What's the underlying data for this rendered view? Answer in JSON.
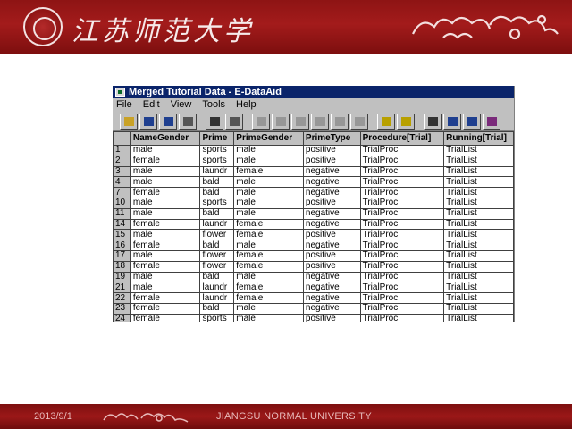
{
  "slide": {
    "university_name": "江苏师范大学",
    "footer_date": "2013/9/1",
    "footer_university": "JIANGSU NORMAL UNIVERSITY"
  },
  "window": {
    "title": "Merged Tutorial Data - E-DataAid",
    "menu": [
      "File",
      "Edit",
      "View",
      "Tools",
      "Help"
    ],
    "toolbar_icons": [
      "open-icon",
      "save-icon",
      "save-as-icon",
      "properties-icon",
      "print-icon",
      "print-preview-icon",
      "undo-icon",
      "copy-icon",
      "paste-icon",
      "cut-icon",
      "find-icon",
      "replace-icon",
      "edit-icon",
      "annotate-icon",
      "table-icon",
      "arrange-columns-icon",
      "filter-icon",
      "analyze-icon"
    ]
  },
  "grid": {
    "columns": [
      "NameGender",
      "Prime",
      "PrimeGender",
      "PrimeType",
      "Procedure[Trial]",
      "Running[Trial]"
    ],
    "rows": [
      {
        "num": "1",
        "cells": [
          "male",
          "sports",
          "male",
          "positive",
          "TrialProc",
          "TrialList"
        ]
      },
      {
        "num": "2",
        "cells": [
          "female",
          "sports",
          "male",
          "positive",
          "TrialProc",
          "TrialList"
        ]
      },
      {
        "num": "3",
        "cells": [
          "male",
          "laundr",
          "female",
          "negative",
          "TrialProc",
          "TrialList"
        ]
      },
      {
        "num": "4",
        "cells": [
          "male",
          "bald",
          "male",
          "negative",
          "TrialProc",
          "TrialList"
        ]
      },
      {
        "num": "7",
        "cells": [
          "female",
          "bald",
          "male",
          "negative",
          "TrialProc",
          "TrialList"
        ]
      },
      {
        "num": "10",
        "cells": [
          "male",
          "sports",
          "male",
          "positive",
          "TrialProc",
          "TrialList"
        ]
      },
      {
        "num": "11",
        "cells": [
          "male",
          "bald",
          "male",
          "negative",
          "TrialProc",
          "TrialList"
        ]
      },
      {
        "num": "14",
        "cells": [
          "female",
          "laundr",
          "female",
          "negative",
          "TrialProc",
          "TrialList"
        ]
      },
      {
        "num": "15",
        "cells": [
          "male",
          "flower",
          "female",
          "positive",
          "TrialProc",
          "TrialList"
        ]
      },
      {
        "num": "16",
        "cells": [
          "female",
          "bald",
          "male",
          "negative",
          "TrialProc",
          "TrialList"
        ]
      },
      {
        "num": "17",
        "cells": [
          "male",
          "flower",
          "female",
          "positive",
          "TrialProc",
          "TrialList"
        ]
      },
      {
        "num": "18",
        "cells": [
          "female",
          "flower",
          "female",
          "positive",
          "TrialProc",
          "TrialList"
        ]
      },
      {
        "num": "19",
        "cells": [
          "male",
          "bald",
          "male",
          "negative",
          "TrialProc",
          "TrialList"
        ]
      },
      {
        "num": "21",
        "cells": [
          "male",
          "laundr",
          "female",
          "negative",
          "TrialProc",
          "TrialList"
        ]
      },
      {
        "num": "22",
        "cells": [
          "female",
          "laundr",
          "female",
          "negative",
          "TrialProc",
          "TrialList"
        ]
      },
      {
        "num": "23",
        "cells": [
          "female",
          "bald",
          "male",
          "negative",
          "TrialProc",
          "TrialList"
        ]
      },
      {
        "num": "24",
        "cells": [
          "female",
          "sports",
          "male",
          "positive",
          "TrialProc",
          "TrialList"
        ]
      }
    ]
  },
  "colors": {
    "banner": "#8e1414",
    "titlebar": "#0a246a",
    "chrome": "#c0c0c0"
  }
}
